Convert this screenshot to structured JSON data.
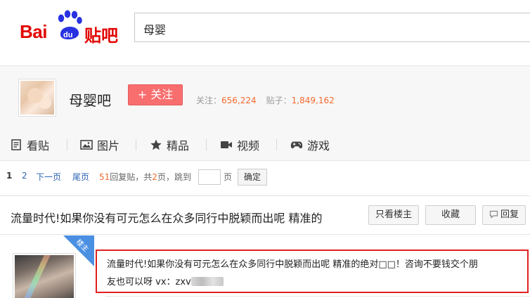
{
  "header": {
    "logo_bai": "Bai",
    "logo_du": "du",
    "logo_tieba": "贴吧",
    "search_value": "母婴"
  },
  "forum": {
    "name": "母婴吧",
    "follow_label": "+ 关注",
    "follow_count_label": "关注：",
    "follow_count": "656,224",
    "post_count_label": "贴子：",
    "post_count": "1,849,162"
  },
  "nav": {
    "items": [
      {
        "label": "看贴",
        "icon": "document-icon"
      },
      {
        "label": "图片",
        "icon": "image-icon"
      },
      {
        "label": "精品",
        "icon": "star-icon"
      },
      {
        "label": "视频",
        "icon": "video-camera-icon"
      },
      {
        "label": "游戏",
        "icon": "gamepad-icon"
      }
    ]
  },
  "pager": {
    "current": "1",
    "page2": "2",
    "next": "下一页",
    "last": "尾页",
    "reply_count": "51",
    "reply_text": "回复贴，共",
    "total_pages": "2",
    "jump_text": "页，跳到",
    "page_unit": "页",
    "confirm": "确定"
  },
  "thread": {
    "title": "流量时代!如果你没有可元怎么在众多同行中脱颖而出呢 精准的",
    "only_host": "只看楼主",
    "collect": "收藏",
    "reply": "回复"
  },
  "post": {
    "badge": "楼主",
    "line1": "流量时代!如果你没有可元怎么在众多同行中脱颖而出呢 精准的绝对□□！咨询不要钱交个朋",
    "line2": "友也可以呀 vx：zxv"
  },
  "colors": {
    "brand_red": "#e10601",
    "brand_blue": "#2932e1",
    "follow_button": "#f86e6e",
    "count_orange": "#f36a2e",
    "link_blue": "#2d64b3",
    "highlight_border": "#e02020",
    "host_badge": "#4a8fe2"
  }
}
